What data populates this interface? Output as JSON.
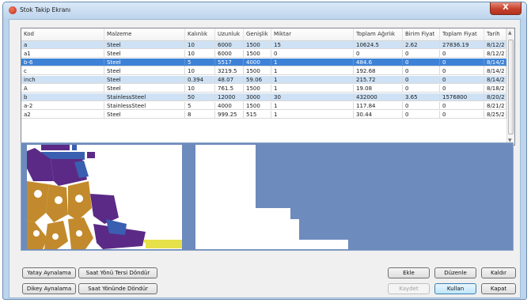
{
  "window": {
    "title": "Stok Takip Ekranı",
    "close_label": "X"
  },
  "grid": {
    "columns": [
      "Kod",
      "Malzeme",
      "Kalınlık",
      "Uzunluk",
      "Genişlik",
      "Miktar",
      "Toplam Ağırlık",
      "Birim Fiyat",
      "Toplam Fiyat",
      "Tarih"
    ],
    "rows": [
      [
        "a",
        "Steel",
        "10",
        "6000",
        "1500",
        "15",
        "10624.5",
        "2.62",
        "27836.19",
        "8/12/2"
      ],
      [
        "a1",
        "Steel",
        "10",
        "6000",
        "1500",
        "0",
        "0",
        "0",
        "0",
        "8/12/2"
      ],
      [
        "b-6",
        "Steel",
        "5",
        "5517",
        "4000",
        "1",
        "484.6",
        "0",
        "0",
        "8/14/2"
      ],
      [
        "c",
        "Steel",
        "10",
        "3219.5",
        "1500",
        "1",
        "192.68",
        "0",
        "0",
        "8/14/2"
      ],
      [
        "inch",
        "Steel",
        "0.394",
        "48.07",
        "59.06",
        "1",
        "215.72",
        "0",
        "0",
        "8/14/2"
      ],
      [
        "A",
        "Steel",
        "10",
        "761.5",
        "1500",
        "1",
        "19.08",
        "0",
        "0",
        "8/18/2"
      ],
      [
        "b",
        "StainlessSteel",
        "50",
        "12000",
        "3000",
        "30",
        "432000",
        "3.65",
        "1576800",
        "8/20/2"
      ],
      [
        "a-2",
        "StainlessSteel",
        "5",
        "4000",
        "1500",
        "1",
        "117.84",
        "0",
        "0",
        "8/21/2"
      ],
      [
        "a2",
        "Steel",
        "8",
        "999.25",
        "515",
        "1",
        "30.44",
        "0",
        "0",
        "8/25/2"
      ]
    ],
    "selected_row": 2
  },
  "buttons": {
    "mirror_h": "Yatay Aynalama",
    "rotate_ccw": "Saat Yönü Tersi Döndür",
    "mirror_v": "Dikey Aynalama",
    "rotate_cw": "Saat Yönünde Döndür",
    "add": "Ekle",
    "edit": "Düzenle",
    "remove": "Kaldır",
    "save": "Kaydet",
    "use": "Kullan",
    "close": "Kapat"
  },
  "colors": {
    "selection": "#3d82d6",
    "preview_bg": "#6d8bbd",
    "part_purple": "#5b2a86",
    "part_orange": "#c28a2c",
    "part_yellow": "#e6e04a",
    "part_blue": "#3a5fb0",
    "part_fill": "#ffffff"
  },
  "icons": {
    "app": "app-icon",
    "close": "close-icon"
  }
}
